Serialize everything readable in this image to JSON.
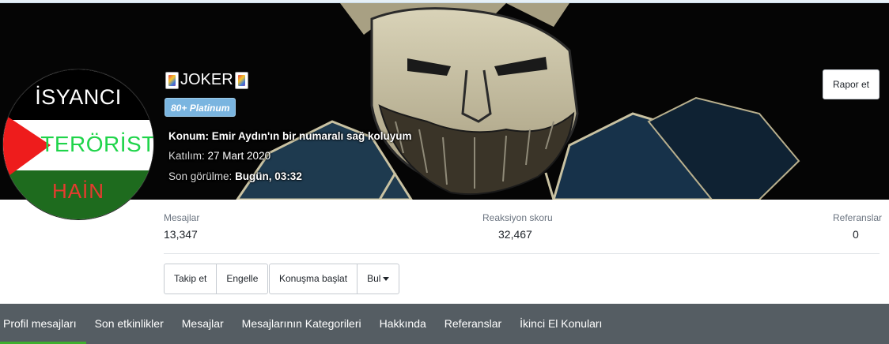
{
  "profile": {
    "username": "JOKER",
    "badge": "80+ Platinum",
    "location_label": "Konum:",
    "location_value": "Emir Aydın'ın bir numaralı sağ koluyum",
    "joined_label": "Katılım:",
    "joined_value": "27 Mart 2020",
    "last_seen_label": "Son görülme:",
    "last_seen_value": "Bugün, 03:32",
    "report_button": "Rapor et"
  },
  "avatar": {
    "line1": "İSYANCI",
    "line2": "TERÖRİST",
    "line3": "HAİN"
  },
  "stats": [
    {
      "label": "Mesajlar",
      "value": "13,347"
    },
    {
      "label": "Reaksiyon skoru",
      "value": "32,467"
    },
    {
      "label": "Referanslar",
      "value": "0"
    }
  ],
  "actions": {
    "follow": "Takip et",
    "block": "Engelle",
    "start_conversation": "Konuşma başlat",
    "find": "Bul"
  },
  "tabs": [
    {
      "label": "Profil mesajları",
      "active": true
    },
    {
      "label": "Son etkinlikler"
    },
    {
      "label": "Mesajlar"
    },
    {
      "label": "Mesajlarının Kategorileri"
    },
    {
      "label": "Hakkında"
    },
    {
      "label": "Referanslar"
    },
    {
      "label": "İkinci El Konuları"
    }
  ],
  "colors": {
    "tab_bar": "#555d63",
    "active_tab_underline": "#3fae2e",
    "badge": "#7ab5e0"
  }
}
